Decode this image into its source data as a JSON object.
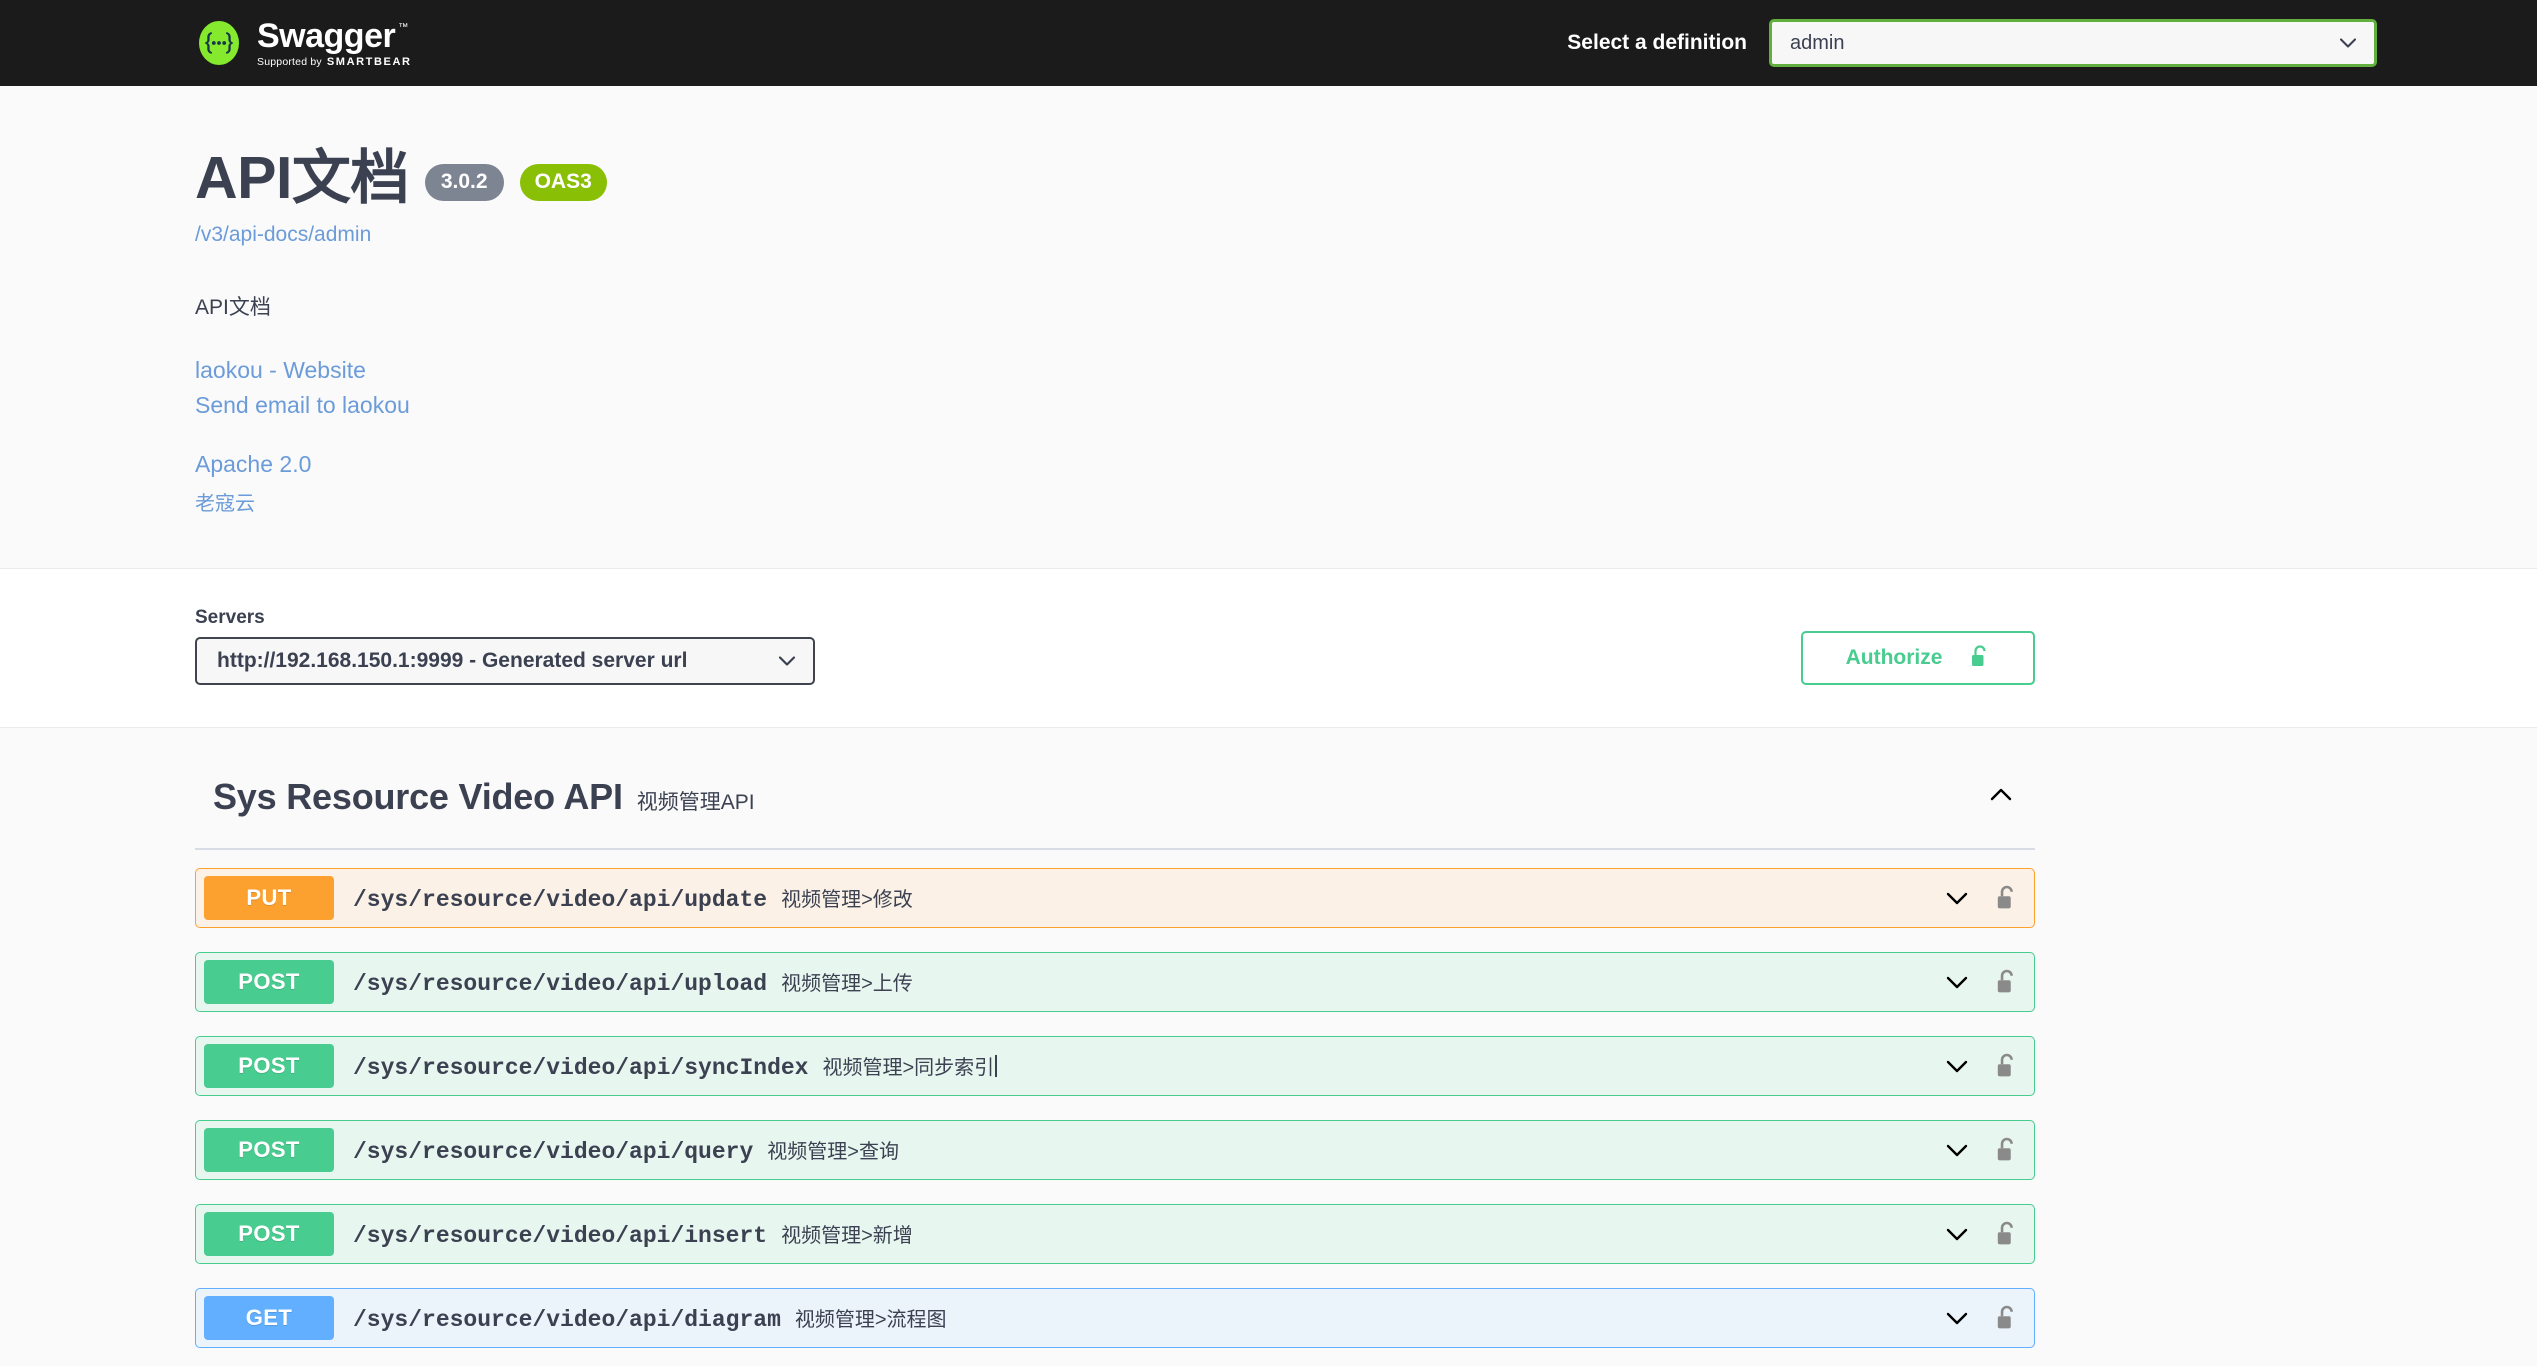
{
  "topbar": {
    "logo_name": "Swagger",
    "logo_tm": "™",
    "logo_supported_by": "Supported by",
    "logo_brand": "SMARTBEAR",
    "definition_label": "Select a definition",
    "definition_value": "admin",
    "definition_options": [
      "admin"
    ],
    "background": "#1b1b1b",
    "select_border": "#62af3f"
  },
  "info": {
    "title": "API文档",
    "version_badge": "3.0.2",
    "oas_badge": "OAS3",
    "doc_url": "/v3/api-docs/admin",
    "description": "API文档",
    "website_link": "laokou - Website",
    "email_link": "Send email to laokou",
    "license_link": "Apache 2.0",
    "terms_link": "老寇云",
    "link_color": "#6b9bd8",
    "version_badge_color": "#7d8492",
    "oas_badge_color": "#89bf04"
  },
  "servers": {
    "label": "Servers",
    "selected": "http://192.168.150.1:9999 - Generated server url",
    "options": [
      "http://192.168.150.1:9999 - Generated server url"
    ],
    "authorize_label": "Authorize",
    "authorize_color": "#49cc90"
  },
  "tag": {
    "title": "Sys Resource Video API",
    "description": "视频管理API",
    "expanded": true,
    "collapse_icon": "chevron-up-icon"
  },
  "operations": [
    {
      "method": "PUT",
      "path": "/sys/resource/video/api/update",
      "summary": "视频管理>修改",
      "style": "put",
      "locked": true,
      "expand_icon": "chevron-down-icon",
      "lock_icon": "unlocked-padlock-icon",
      "caret_after_summary": false
    },
    {
      "method": "POST",
      "path": "/sys/resource/video/api/upload",
      "summary": "视频管理>上传",
      "style": "post",
      "locked": true,
      "expand_icon": "chevron-down-icon",
      "lock_icon": "unlocked-padlock-icon",
      "caret_after_summary": false
    },
    {
      "method": "POST",
      "path": "/sys/resource/video/api/syncIndex",
      "summary": "视频管理>同步索引",
      "style": "post",
      "locked": true,
      "expand_icon": "chevron-down-icon",
      "lock_icon": "unlocked-padlock-icon",
      "caret_after_summary": true
    },
    {
      "method": "POST",
      "path": "/sys/resource/video/api/query",
      "summary": "视频管理>查询",
      "style": "post",
      "locked": true,
      "expand_icon": "chevron-down-icon",
      "lock_icon": "unlocked-padlock-icon",
      "caret_after_summary": false
    },
    {
      "method": "POST",
      "path": "/sys/resource/video/api/insert",
      "summary": "视频管理>新增",
      "style": "post",
      "locked": true,
      "expand_icon": "chevron-down-icon",
      "lock_icon": "unlocked-padlock-icon",
      "caret_after_summary": false
    },
    {
      "method": "GET",
      "path": "/sys/resource/video/api/diagram",
      "summary": "视频管理>流程图",
      "style": "get",
      "locked": true,
      "expand_icon": "chevron-down-icon",
      "lock_icon": "unlocked-padlock-icon",
      "caret_after_summary": false
    }
  ]
}
